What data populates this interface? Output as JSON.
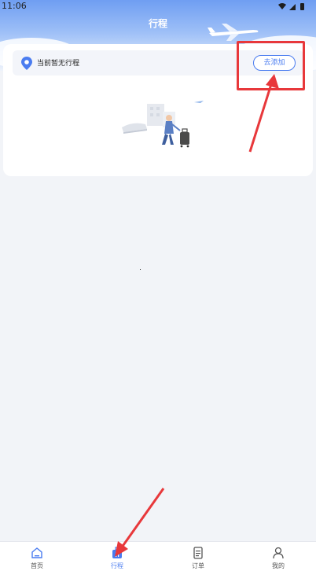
{
  "status_bar": {
    "time": "11:06"
  },
  "header": {
    "title": "行程"
  },
  "trip_card": {
    "status_text": "当前暂无行程",
    "add_button_label": "去添加"
  },
  "tab_bar": {
    "items": [
      {
        "label": "首页",
        "icon": "home-icon",
        "active": false
      },
      {
        "label": "行程",
        "icon": "suitcase-icon",
        "active": true
      },
      {
        "label": "订单",
        "icon": "document-icon",
        "active": false
      },
      {
        "label": "我的",
        "icon": "user-icon",
        "active": false
      }
    ]
  },
  "colors": {
    "accent": "#4a7cf0",
    "annotation": "#e8383b",
    "background": "#f2f4f8"
  }
}
